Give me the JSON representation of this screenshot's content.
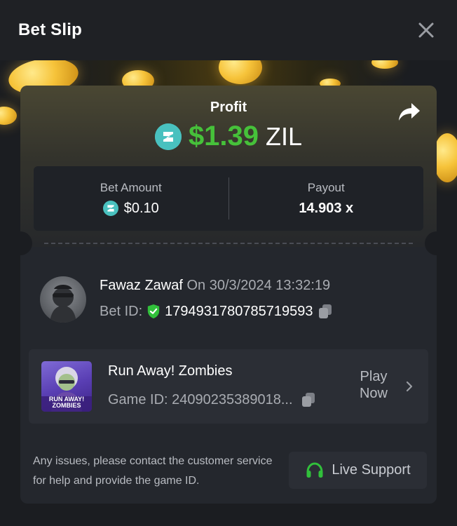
{
  "header": {
    "title": "Bet Slip"
  },
  "profit": {
    "label": "Profit",
    "amount": "$1.39",
    "currency": "ZIL",
    "icon": "zilliqa-icon"
  },
  "stats": {
    "bet_amount_label": "Bet Amount",
    "bet_amount_value": "$0.10",
    "payout_label": "Payout",
    "payout_value": "14.903 x"
  },
  "user": {
    "name": "Fawaz Zawaf",
    "date": "On 30/3/2024 13:32:19",
    "bet_id_label": "Bet ID:",
    "bet_id_value": "179493178078571959​3"
  },
  "game": {
    "title": "Run Away! Zombies",
    "game_id_text": "Game ID: 24090235389018...",
    "thumb_text": "RUN AWAY! ZOMBIES",
    "play_label_line1": "Play",
    "play_label_line2": "Now"
  },
  "footer": {
    "help_text": "Any issues, please contact the customer service for help and provide the game ID.",
    "support_label": "Live Support"
  },
  "colors": {
    "profit_green": "#46c13a",
    "zil_teal": "#49c1bf",
    "shield_green": "#31c03b",
    "headset_green": "#31c03b"
  }
}
